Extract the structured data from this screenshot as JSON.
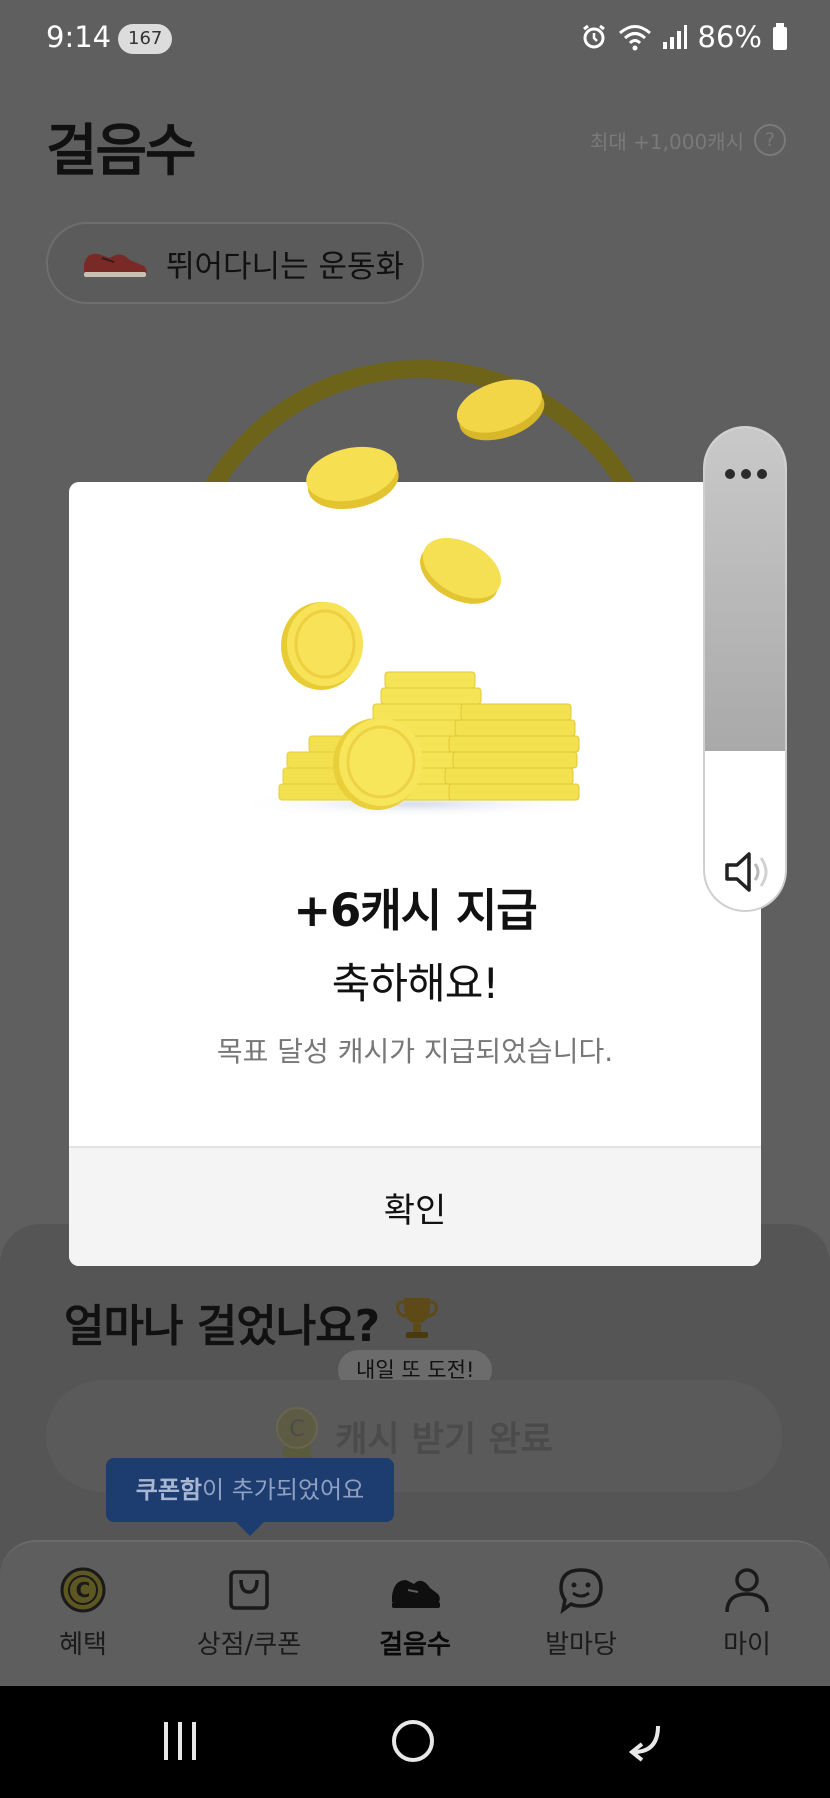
{
  "status_bar": {
    "time": "9:14",
    "notification_count": "167",
    "battery": "86%"
  },
  "header": {
    "title": "걸음수",
    "max_cash": "최대 +1,000캐시",
    "help_icon": "?"
  },
  "shoe_chip": {
    "label": "뛰어다니는 운동화",
    "icon": "sneaker-icon"
  },
  "modal": {
    "title": "+6캐시 지급",
    "subtitle": "축하해요!",
    "description": "목표 달성 캐시가 지급되었습니다.",
    "confirm_label": "확인",
    "illustration": "coin-stack"
  },
  "walk_section": {
    "title": "얼마나 걸었나요?",
    "tomorrow_tip": "내일 또 도전!",
    "cash_done_label": "캐시 받기 완료"
  },
  "coupon_toast": {
    "bold": "쿠폰함",
    "rest": "이 추가되었어요"
  },
  "volume": {
    "level": 0.33
  },
  "bottom_nav": {
    "items": [
      {
        "label": "혜택",
        "icon": "coin-icon"
      },
      {
        "label": "상점/쿠폰",
        "icon": "shopping-bag-icon"
      },
      {
        "label": "걸음수",
        "icon": "sneaker-icon",
        "active": true
      },
      {
        "label": "발마당",
        "icon": "chat-smile-icon"
      },
      {
        "label": "마이",
        "icon": "person-icon"
      }
    ]
  },
  "colors": {
    "dim_overlay": "#5f5f5f",
    "coin_yellow": "#f7dc4a",
    "toast_blue": "#1d3c70"
  }
}
